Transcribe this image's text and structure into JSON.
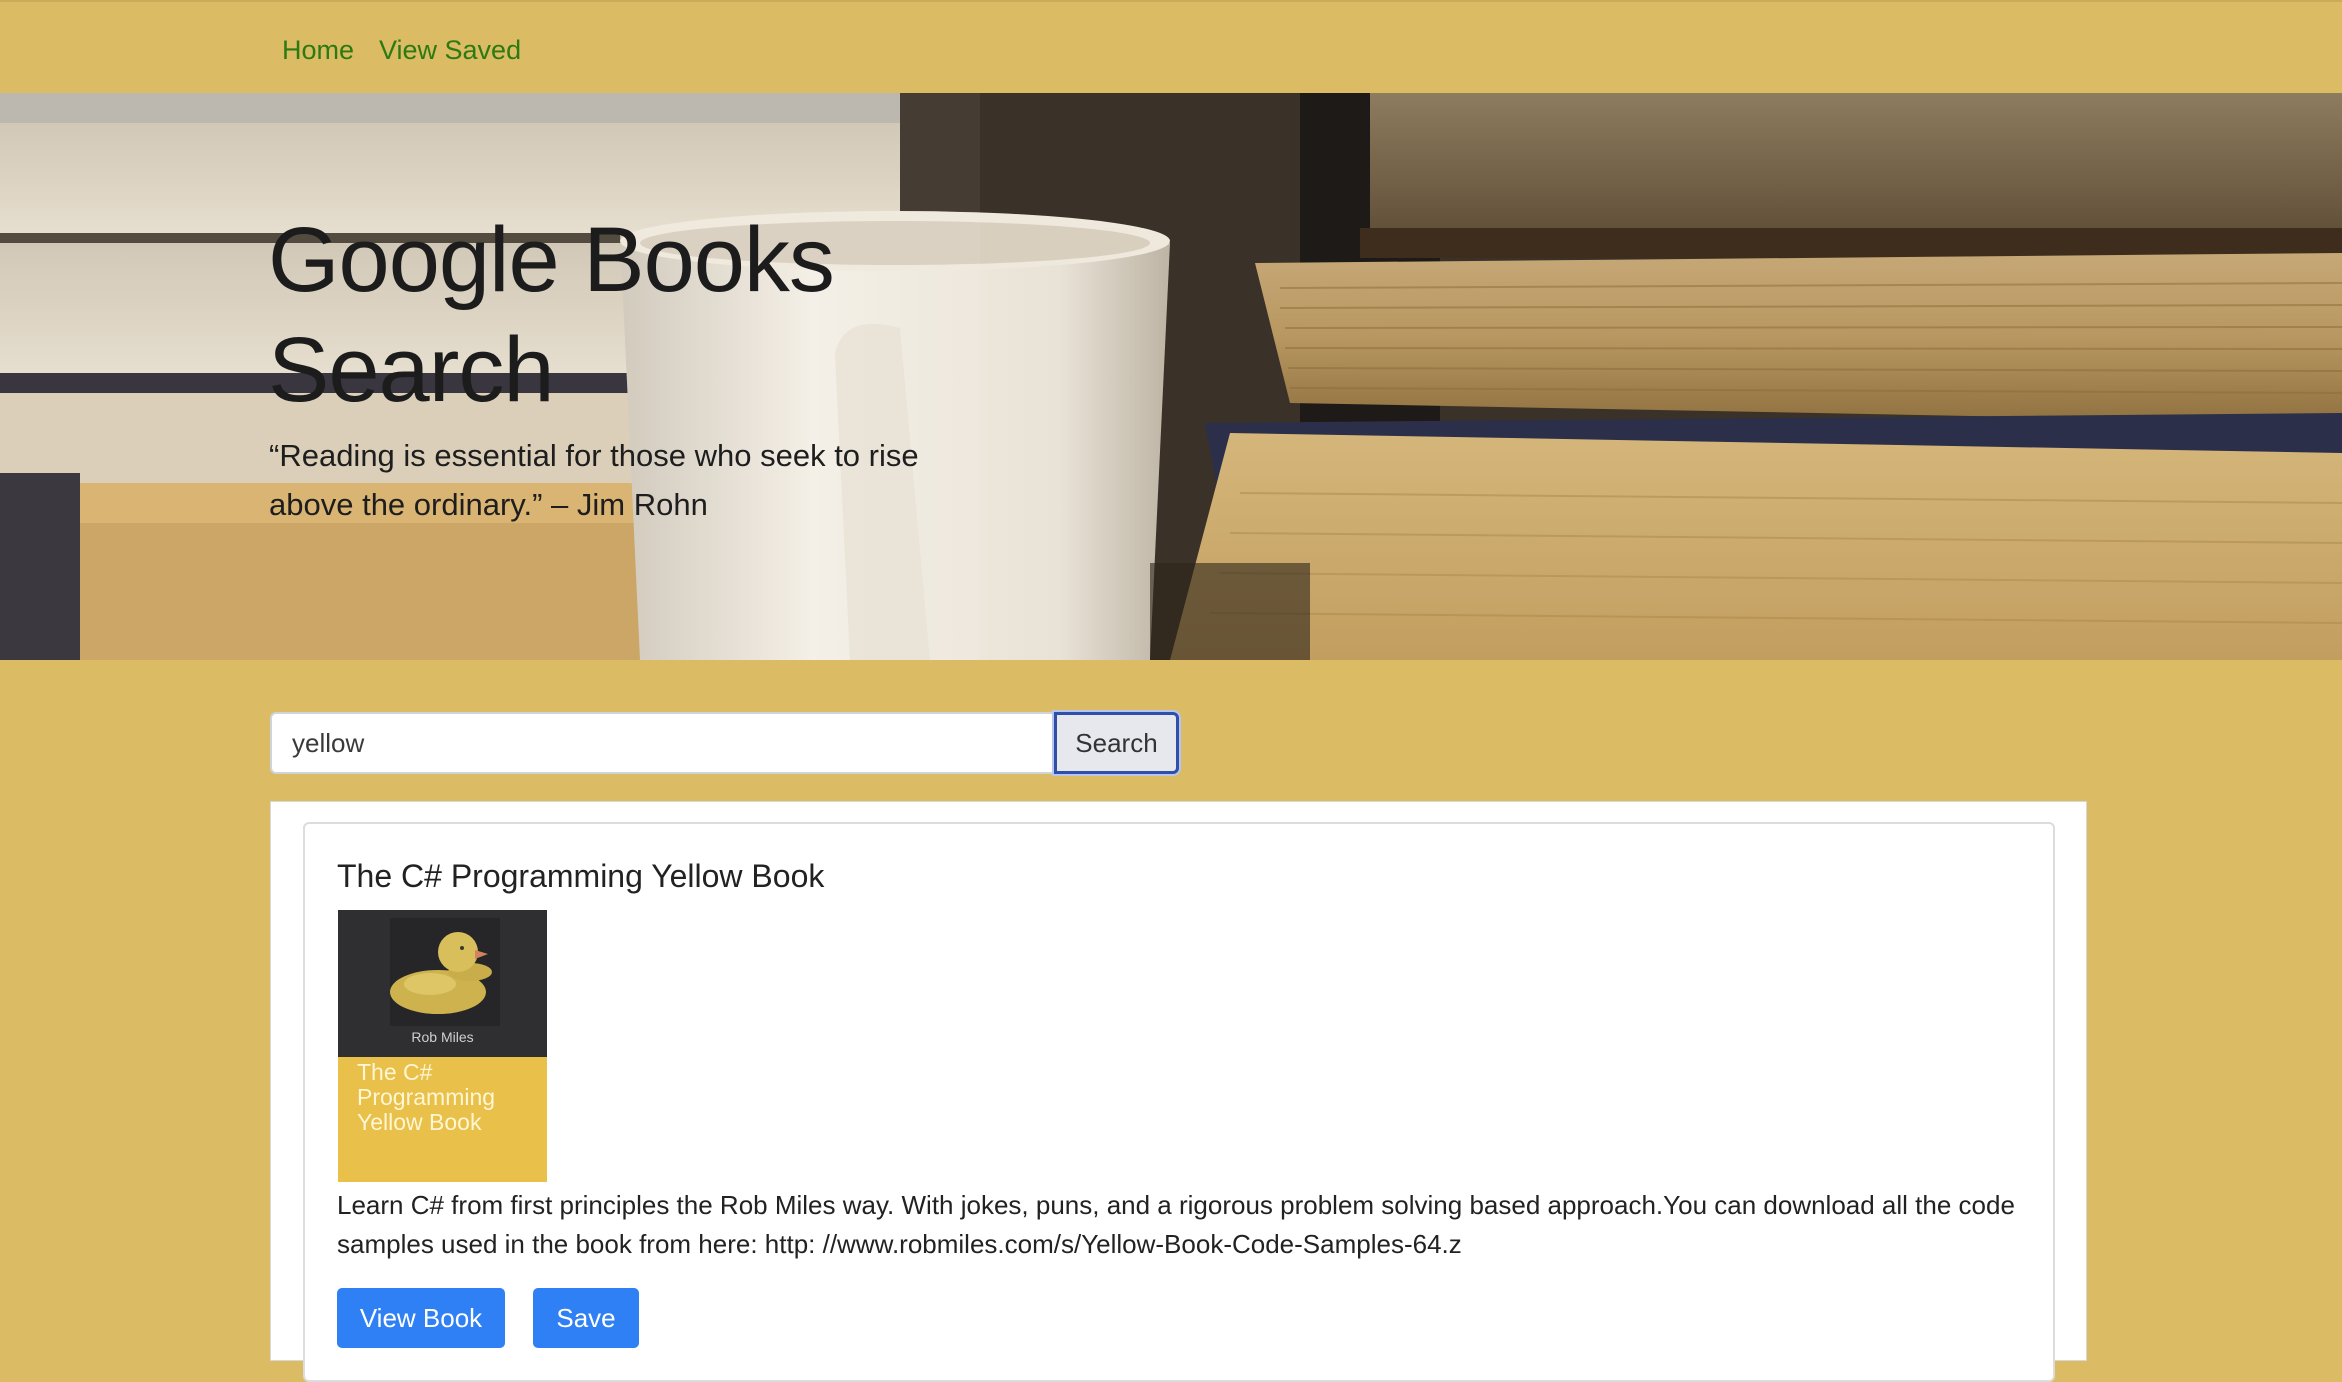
{
  "nav": {
    "home_label": "Home",
    "saved_label": "View Saved"
  },
  "hero": {
    "title": "Google Books Search",
    "quote": "“Reading is essential for those who seek to rise above the ordinary.” – Jim Rohn"
  },
  "search": {
    "value": "yellow",
    "button_label": "Search"
  },
  "results": [
    {
      "title": "The C# Programming Yellow Book",
      "cover_author": "Rob Miles",
      "cover_title": "The C# Programming Yellow Book",
      "description": "Learn C# from first principles the Rob Miles way. With jokes, puns, and a rigorous problem solving based approach.You can download all the code samples used in the book from here: http: //www.robmiles.com/s/Yellow-Book-Code-Samples-64.z",
      "view_label": "View Book",
      "save_label": "Save"
    }
  ],
  "colors": {
    "page_background": "#dbbb63",
    "nav_link": "#2c7a12",
    "primary_button": "#2f7ff5"
  }
}
